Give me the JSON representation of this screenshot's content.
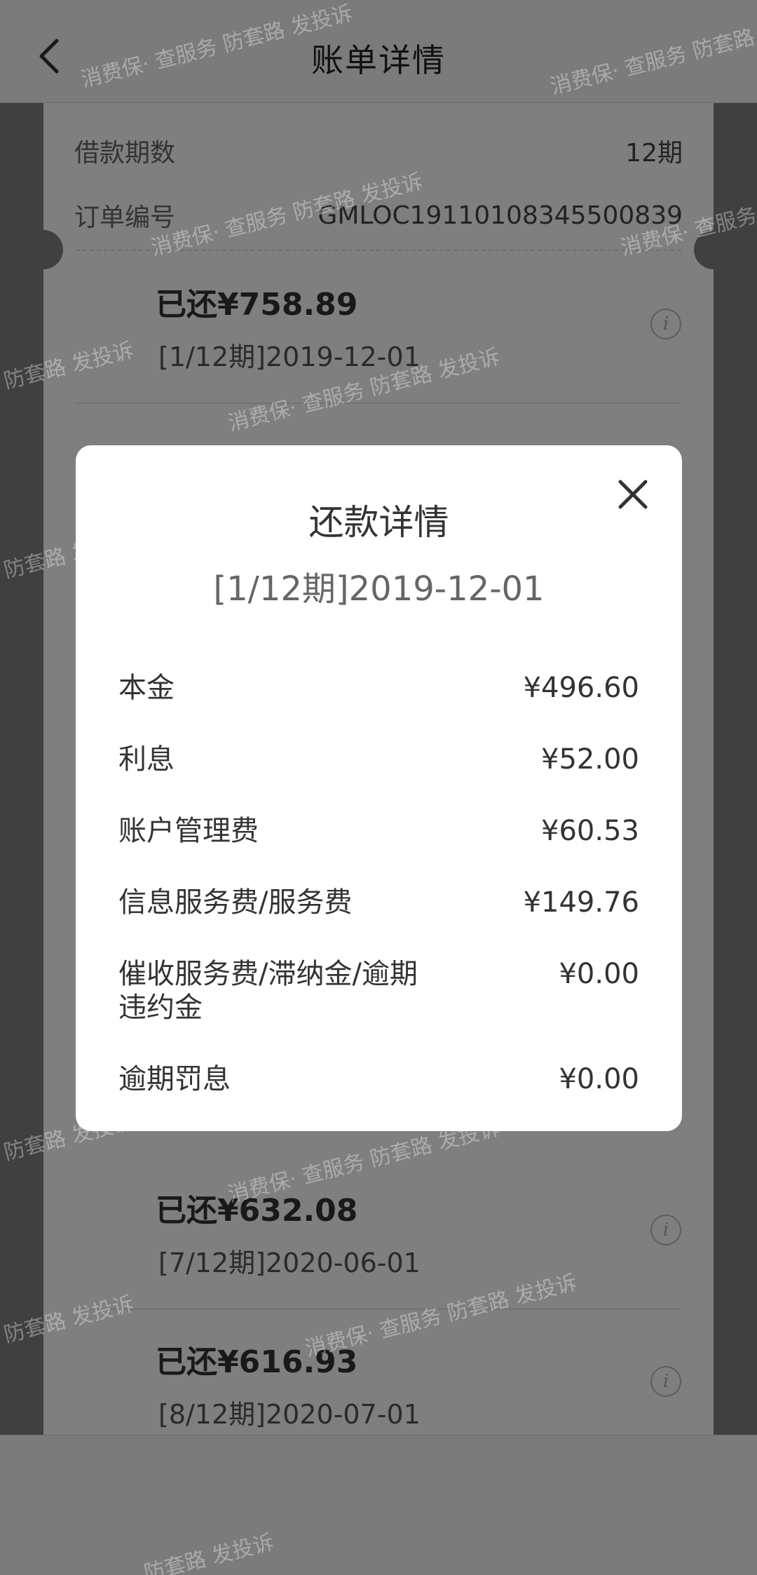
{
  "header": {
    "title": "账单详情",
    "back_icon": "chevron-left-icon"
  },
  "order_info": {
    "periods_label": "借款期数",
    "periods_value": "12期",
    "order_no_label": "订单编号",
    "order_no_value": "GMLOC19110108345500839"
  },
  "bills": [
    {
      "paid": "已还¥758.89",
      "period": "[1/12期]2019-12-01"
    },
    {
      "paid": "已还¥632.08",
      "period": "[7/12期]2020-06-01"
    },
    {
      "paid": "已还¥616.93",
      "period": "[8/12期]2020-07-01"
    }
  ],
  "watermark": {
    "brand": "消费保",
    "text": "· 查服务 防套路 发投诉",
    "partial": "防套路 发投诉"
  },
  "modal": {
    "title": "还款详情",
    "subtitle": "[1/12期]2019-12-01",
    "rows": [
      {
        "label": "本金",
        "amount": "¥496.60"
      },
      {
        "label": "利息",
        "amount": "¥52.00"
      },
      {
        "label": "账户管理费",
        "amount": "¥60.53"
      },
      {
        "label": "信息服务费/服务费",
        "amount": "¥149.76"
      },
      {
        "label": "催收服务费/滞纳金/逾期违约金",
        "amount": "¥0.00"
      },
      {
        "label": "逾期罚息",
        "amount": "¥0.00"
      }
    ]
  },
  "colors": {
    "modal_bg": "#ffffff",
    "overlay": "rgba(0,0,0,0.5)"
  }
}
